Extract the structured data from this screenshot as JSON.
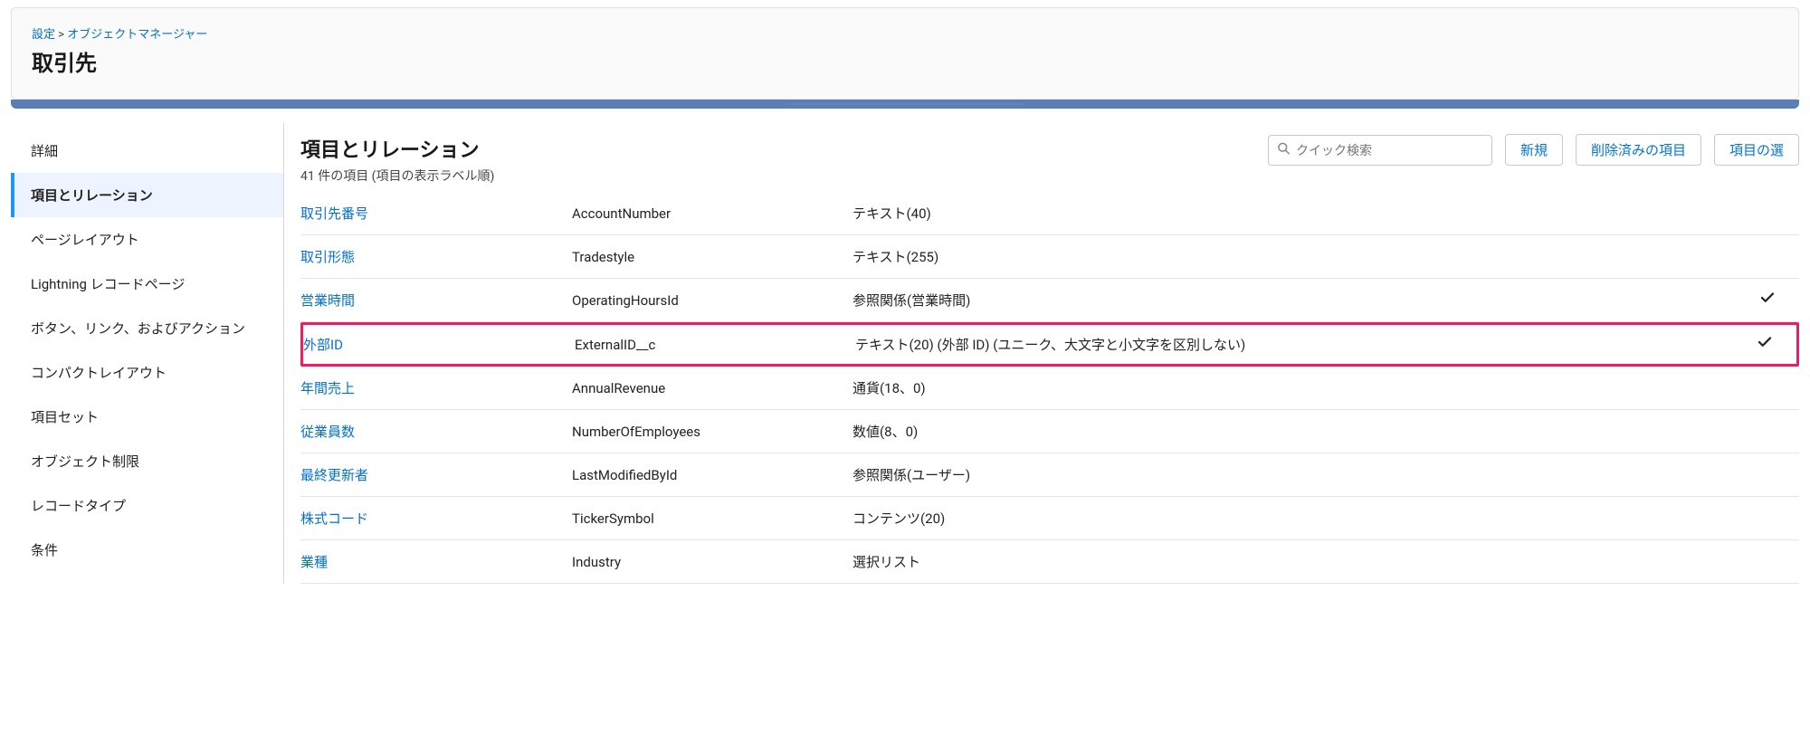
{
  "breadcrumb": {
    "settings": "設定",
    "sep": ">",
    "object_mgr": "オブジェクトマネージャー"
  },
  "page_title": "取引先",
  "sidebar": {
    "items": [
      {
        "label": "詳細"
      },
      {
        "label": "項目とリレーション",
        "selected": true
      },
      {
        "label": "ページレイアウト"
      },
      {
        "label": "Lightning レコードページ"
      },
      {
        "label": "ボタン、リンク、およびアクション"
      },
      {
        "label": "コンパクトレイアウト"
      },
      {
        "label": "項目セット"
      },
      {
        "label": "オブジェクト制限"
      },
      {
        "label": "レコードタイプ"
      },
      {
        "label": "条件"
      }
    ]
  },
  "main": {
    "title": "項目とリレーション",
    "subtitle": "41 件の項目 (項目の表示ラベル順)",
    "search_placeholder": "クイック検索",
    "buttons": {
      "new": "新規",
      "deleted": "削除済みの項目",
      "depend": "項目の選"
    },
    "rows": [
      {
        "label": "取引先番号",
        "api": "AccountNumber",
        "type": "テキスト(40)",
        "check": false
      },
      {
        "label": "取引形態",
        "api": "Tradestyle",
        "type": "テキスト(255)",
        "check": false
      },
      {
        "label": "営業時間",
        "api": "OperatingHoursId",
        "type": "参照関係(営業時間)",
        "check": true
      },
      {
        "label": "外部ID",
        "api": "ExternalID__c",
        "type": "テキスト(20) (外部 ID) (ユニーク、大文字と小文字を区別しない)",
        "check": true,
        "highlight": true
      },
      {
        "label": "年間売上",
        "api": "AnnualRevenue",
        "type": "通貨(18、0)",
        "check": false
      },
      {
        "label": "従業員数",
        "api": "NumberOfEmployees",
        "type": "数値(8、0)",
        "check": false
      },
      {
        "label": "最終更新者",
        "api": "LastModifiedById",
        "type": "参照関係(ユーザー)",
        "check": false
      },
      {
        "label": "株式コード",
        "api": "TickerSymbol",
        "type": "コンテンツ(20)",
        "check": false
      },
      {
        "label": "業種",
        "api": "Industry",
        "type": "選択リスト",
        "check": false
      }
    ]
  }
}
